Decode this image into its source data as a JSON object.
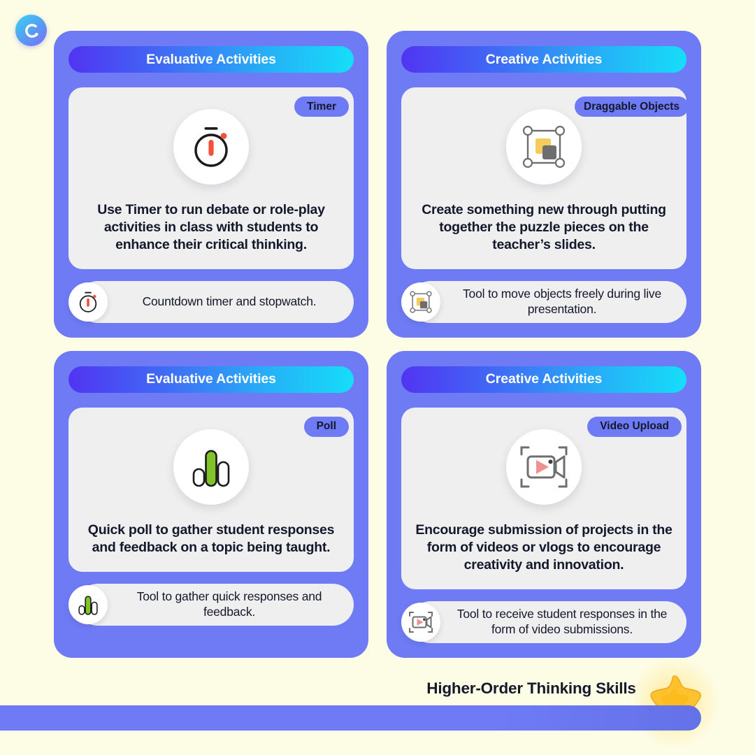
{
  "brand": {
    "logo_icon": "letter-c-circle-logo",
    "logo_letter": "C"
  },
  "caption": {
    "text": "Higher-Order Thinking Skills",
    "star_icon": "star-icon"
  },
  "colors": {
    "background": "#FDFCE4",
    "card": "#6E7BF5",
    "pill": "#6E7BF5",
    "header_gradient_start": "#5134F2",
    "header_gradient_end": "#16DEF8",
    "inner_panel": "#EFEFEF",
    "text_dark": "#14182B",
    "accent_red": "#F0523C",
    "accent_green": "#80C428",
    "accent_yellow": "#F5CB5C",
    "accent_gray": "#6E6E6E",
    "accent_salmon": "#EE9191",
    "star_yellow": "#FDC22D"
  },
  "cards": [
    {
      "header": "Evaluative Activities",
      "tool": "Timer",
      "icon": "timer-icon",
      "description": "Use Timer to run debate or role-play activities in class with students to enhance their critical thinking.",
      "footer_text": "Countdown timer and stopwatch.",
      "footer_icon": "timer-icon"
    },
    {
      "header": "Creative Activities",
      "tool": "Draggable Objects",
      "icon": "draggable-objects-icon",
      "description": "Create something new through putting together the puzzle pieces on the teacher’s slides.",
      "footer_text": "Tool to move objects freely during live presentation.",
      "footer_icon": "draggable-objects-icon"
    },
    {
      "header": "Evaluative Activities",
      "tool": "Poll",
      "icon": "poll-bars-icon",
      "description": "Quick poll to gather student responses and feedback on a topic being taught.",
      "footer_text": "Tool to gather quick responses and feedback.",
      "footer_icon": "poll-bars-icon"
    },
    {
      "header": "Creative Activities",
      "tool": "Video Upload",
      "icon": "video-camera-icon",
      "description": "Encourage submission of projects in the form of videos or vlogs to encourage creativity and innovation.",
      "footer_text": "Tool to receive student responses in the form of video submissions.",
      "footer_icon": "video-camera-icon"
    }
  ]
}
